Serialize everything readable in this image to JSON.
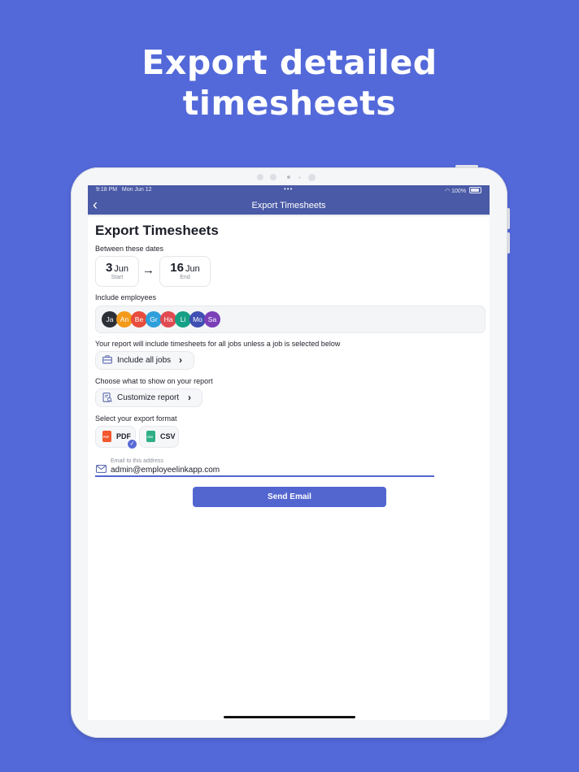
{
  "headline": {
    "line1": "Export detailed",
    "line2": "timesheets"
  },
  "status_bar": {
    "time": "9:18 PM",
    "date": "Mon Jun 12",
    "dots": "•••",
    "battery": "100%"
  },
  "nav": {
    "back": "‹",
    "title": "Export Timesheets"
  },
  "page": {
    "title": "Export Timesheets",
    "dates_label": "Between these dates",
    "start": {
      "day": "3",
      "month": "Jun",
      "caption": "Start"
    },
    "end": {
      "day": "16",
      "month": "Jun",
      "caption": "End"
    },
    "date_arrow": "→",
    "employees_label": "Include employees",
    "employees": [
      {
        "initials": "Ja",
        "color": "#2c2f36"
      },
      {
        "initials": "An",
        "color": "#f39a1a"
      },
      {
        "initials": "Be",
        "color": "#e74c3c"
      },
      {
        "initials": "Gr",
        "color": "#2d9fdb"
      },
      {
        "initials": "Ha",
        "color": "#e04a52"
      },
      {
        "initials": "Li",
        "color": "#16a085"
      },
      {
        "initials": "Mo",
        "color": "#3f4fb3"
      },
      {
        "initials": "Sa",
        "color": "#7b3fb8"
      }
    ],
    "jobs_note": "Your report will include timesheets for all jobs unless a job is selected below",
    "jobs_button": "Include all jobs",
    "customize_label": "Choose what to show on your report",
    "customize_button": "Customize report",
    "format_label": "Select your export format",
    "formats": [
      {
        "label": "PDF",
        "icon": "pdf-file-icon",
        "icon_text": "PDF",
        "color": "#f2572d",
        "selected": true
      },
      {
        "label": "CSV",
        "icon": "csv-file-icon",
        "icon_text": "CSV",
        "color": "#2eaf86",
        "selected": false
      }
    ],
    "email_label": "Email to this address",
    "email_value": "admin@employeelinkapp.com",
    "send_button": "Send Email",
    "chevron": "›",
    "check": "✓"
  },
  "colors": {
    "background": "#5369d9",
    "navbar": "#4a5aa6",
    "accent": "#5366d0"
  }
}
